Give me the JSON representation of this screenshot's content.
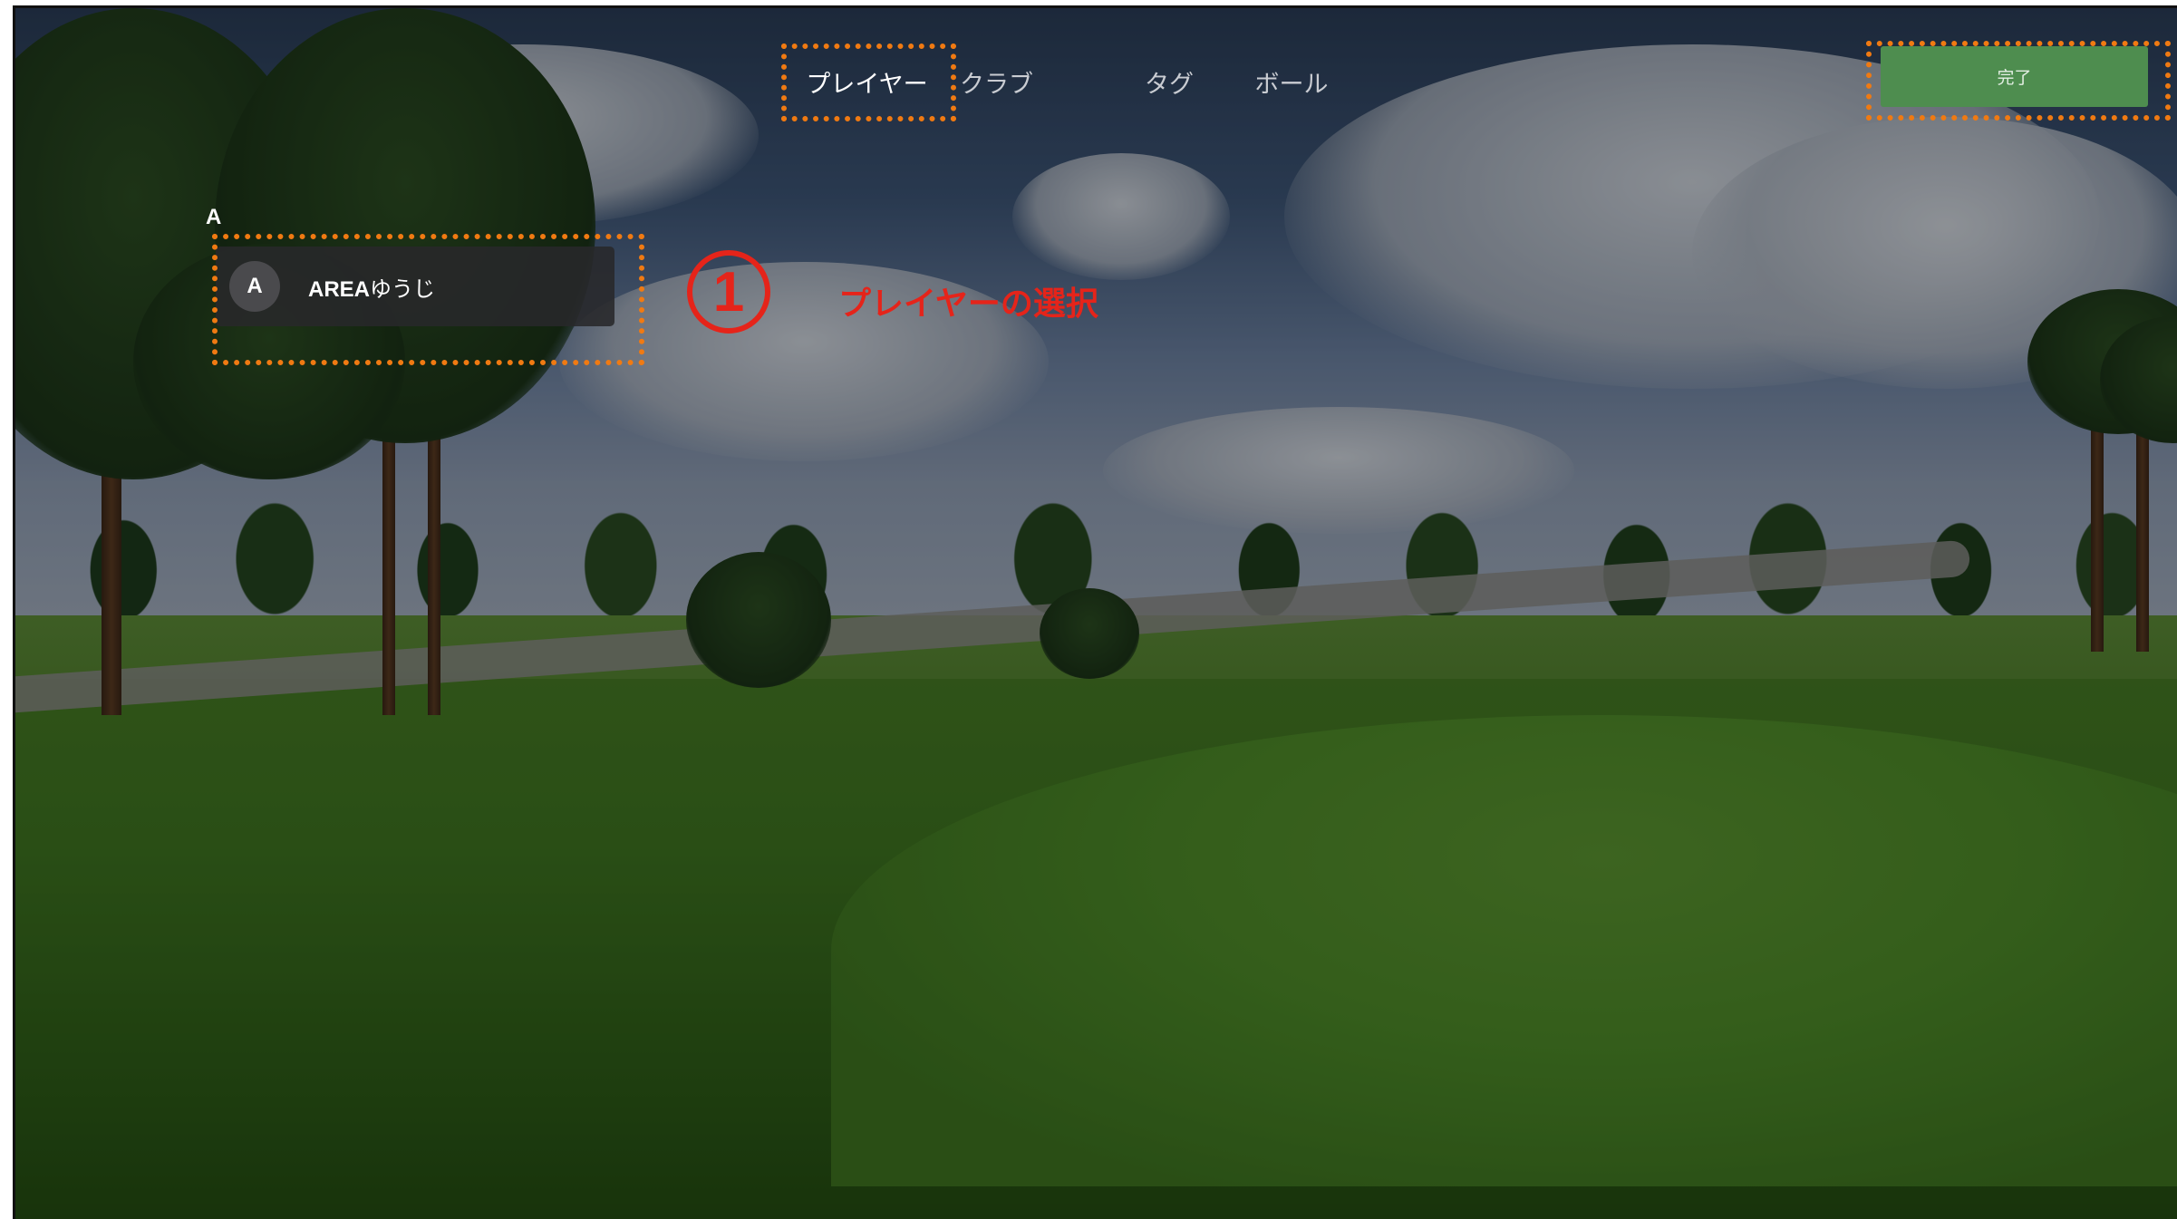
{
  "tabs": [
    {
      "label": "プレイヤー",
      "active": true
    },
    {
      "label": "クラブ",
      "active": false
    },
    {
      "label": "タグ",
      "active": false
    },
    {
      "label": "ボール",
      "active": false
    }
  ],
  "done_button": {
    "label": "完了"
  },
  "player_list": {
    "group_letter": "A",
    "players": [
      {
        "avatar_initial": "A",
        "name_prefix": "AREA",
        "name_suffix": "ゆうじ"
      }
    ]
  },
  "annotation": {
    "step_number": "1",
    "label": "プレイヤーの選択"
  },
  "colors": {
    "highlight": "#f07a12",
    "annotation": "#e5241a",
    "done_button": "#4e8d4f"
  }
}
